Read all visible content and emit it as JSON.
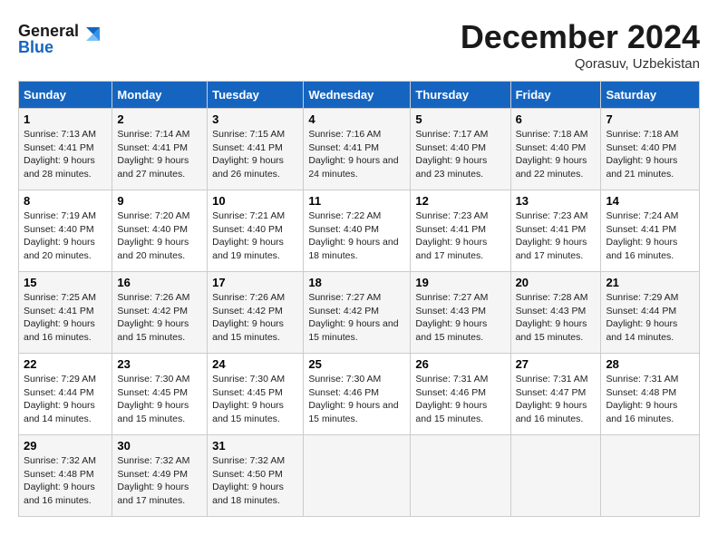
{
  "header": {
    "logo_line1": "General",
    "logo_line2": "Blue",
    "month_title": "December 2024",
    "subtitle": "Qorasuv, Uzbekistan"
  },
  "days_of_week": [
    "Sunday",
    "Monday",
    "Tuesday",
    "Wednesday",
    "Thursday",
    "Friday",
    "Saturday"
  ],
  "weeks": [
    [
      {
        "day": "1",
        "sunrise": "7:13 AM",
        "sunset": "4:41 PM",
        "daylight": "9 hours and 28 minutes."
      },
      {
        "day": "2",
        "sunrise": "7:14 AM",
        "sunset": "4:41 PM",
        "daylight": "9 hours and 27 minutes."
      },
      {
        "day": "3",
        "sunrise": "7:15 AM",
        "sunset": "4:41 PM",
        "daylight": "9 hours and 26 minutes."
      },
      {
        "day": "4",
        "sunrise": "7:16 AM",
        "sunset": "4:41 PM",
        "daylight": "9 hours and 24 minutes."
      },
      {
        "day": "5",
        "sunrise": "7:17 AM",
        "sunset": "4:40 PM",
        "daylight": "9 hours and 23 minutes."
      },
      {
        "day": "6",
        "sunrise": "7:18 AM",
        "sunset": "4:40 PM",
        "daylight": "9 hours and 22 minutes."
      },
      {
        "day": "7",
        "sunrise": "7:18 AM",
        "sunset": "4:40 PM",
        "daylight": "9 hours and 21 minutes."
      }
    ],
    [
      {
        "day": "8",
        "sunrise": "7:19 AM",
        "sunset": "4:40 PM",
        "daylight": "9 hours and 20 minutes."
      },
      {
        "day": "9",
        "sunrise": "7:20 AM",
        "sunset": "4:40 PM",
        "daylight": "9 hours and 20 minutes."
      },
      {
        "day": "10",
        "sunrise": "7:21 AM",
        "sunset": "4:40 PM",
        "daylight": "9 hours and 19 minutes."
      },
      {
        "day": "11",
        "sunrise": "7:22 AM",
        "sunset": "4:40 PM",
        "daylight": "9 hours and 18 minutes."
      },
      {
        "day": "12",
        "sunrise": "7:23 AM",
        "sunset": "4:41 PM",
        "daylight": "9 hours and 17 minutes."
      },
      {
        "day": "13",
        "sunrise": "7:23 AM",
        "sunset": "4:41 PM",
        "daylight": "9 hours and 17 minutes."
      },
      {
        "day": "14",
        "sunrise": "7:24 AM",
        "sunset": "4:41 PM",
        "daylight": "9 hours and 16 minutes."
      }
    ],
    [
      {
        "day": "15",
        "sunrise": "7:25 AM",
        "sunset": "4:41 PM",
        "daylight": "9 hours and 16 minutes."
      },
      {
        "day": "16",
        "sunrise": "7:26 AM",
        "sunset": "4:42 PM",
        "daylight": "9 hours and 15 minutes."
      },
      {
        "day": "17",
        "sunrise": "7:26 AM",
        "sunset": "4:42 PM",
        "daylight": "9 hours and 15 minutes."
      },
      {
        "day": "18",
        "sunrise": "7:27 AM",
        "sunset": "4:42 PM",
        "daylight": "9 hours and 15 minutes."
      },
      {
        "day": "19",
        "sunrise": "7:27 AM",
        "sunset": "4:43 PM",
        "daylight": "9 hours and 15 minutes."
      },
      {
        "day": "20",
        "sunrise": "7:28 AM",
        "sunset": "4:43 PM",
        "daylight": "9 hours and 15 minutes."
      },
      {
        "day": "21",
        "sunrise": "7:29 AM",
        "sunset": "4:44 PM",
        "daylight": "9 hours and 14 minutes."
      }
    ],
    [
      {
        "day": "22",
        "sunrise": "7:29 AM",
        "sunset": "4:44 PM",
        "daylight": "9 hours and 14 minutes."
      },
      {
        "day": "23",
        "sunrise": "7:30 AM",
        "sunset": "4:45 PM",
        "daylight": "9 hours and 15 minutes."
      },
      {
        "day": "24",
        "sunrise": "7:30 AM",
        "sunset": "4:45 PM",
        "daylight": "9 hours and 15 minutes."
      },
      {
        "day": "25",
        "sunrise": "7:30 AM",
        "sunset": "4:46 PM",
        "daylight": "9 hours and 15 minutes."
      },
      {
        "day": "26",
        "sunrise": "7:31 AM",
        "sunset": "4:46 PM",
        "daylight": "9 hours and 15 minutes."
      },
      {
        "day": "27",
        "sunrise": "7:31 AM",
        "sunset": "4:47 PM",
        "daylight": "9 hours and 16 minutes."
      },
      {
        "day": "28",
        "sunrise": "7:31 AM",
        "sunset": "4:48 PM",
        "daylight": "9 hours and 16 minutes."
      }
    ],
    [
      {
        "day": "29",
        "sunrise": "7:32 AM",
        "sunset": "4:48 PM",
        "daylight": "9 hours and 16 minutes."
      },
      {
        "day": "30",
        "sunrise": "7:32 AM",
        "sunset": "4:49 PM",
        "daylight": "9 hours and 17 minutes."
      },
      {
        "day": "31",
        "sunrise": "7:32 AM",
        "sunset": "4:50 PM",
        "daylight": "9 hours and 18 minutes."
      },
      null,
      null,
      null,
      null
    ]
  ],
  "labels": {
    "sunrise": "Sunrise:",
    "sunset": "Sunset:",
    "daylight": "Daylight:"
  }
}
